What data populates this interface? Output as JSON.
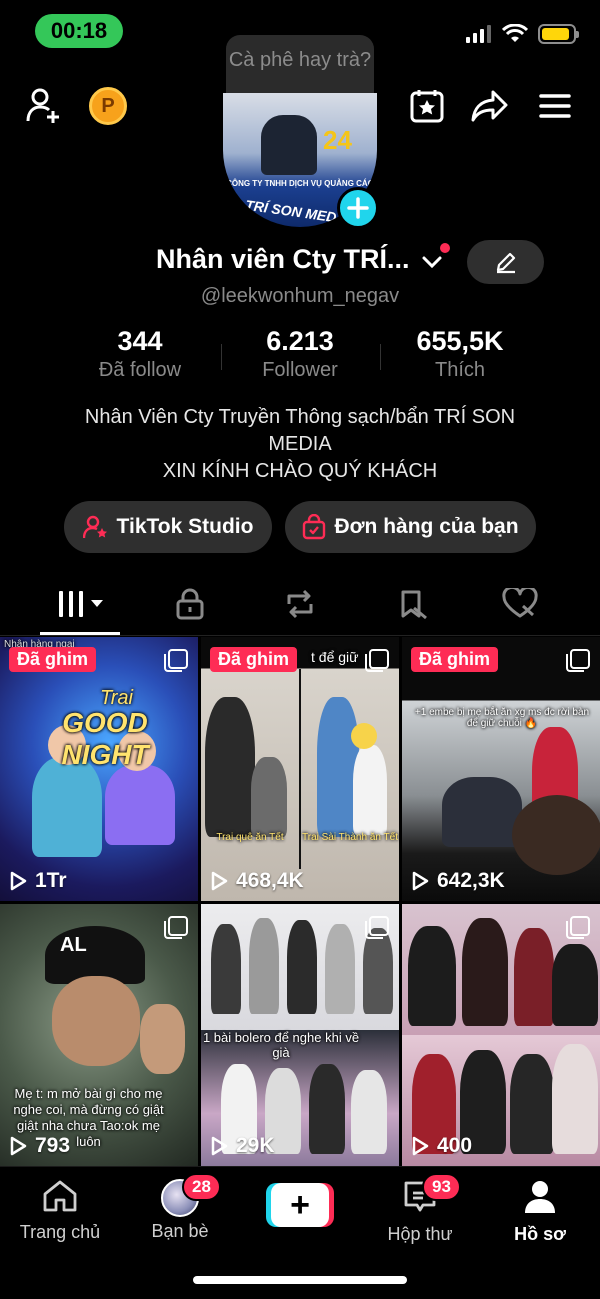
{
  "status_bar": {
    "time": "00:18",
    "battery_level": 0.9,
    "battery_color": "#ffd60a"
  },
  "top_nav": {
    "coin_label": "P",
    "tooltip": "Cà phê hay trà?"
  },
  "profile": {
    "avatar_badge": "24",
    "avatar_company": "CÔNG TY TNHH DỊCH VỤ QUẢNG CÁO",
    "avatar_brand": "TRÍ SON MED",
    "name": "Nhân viên Cty TRÍ...",
    "handle": "@leekwonhum_negav",
    "stats": [
      {
        "value": "344",
        "label": "Đã follow"
      },
      {
        "value": "6.213",
        "label": "Follower"
      },
      {
        "value": "655,5K",
        "label": "Thích"
      }
    ],
    "bio_line1": "Nhân Viên Cty Truyền Thông sạch/bẩn TRÍ SON",
    "bio_line2": "MEDIA",
    "bio_line3": "XIN KÍNH CHÀO QUÝ KHÁCH",
    "buttons": {
      "studio": "TikTok Studio",
      "orders": "Đơn hàng của bạn"
    }
  },
  "tabs": [
    "videos-tab",
    "private-tab",
    "repost-tab",
    "favorites-tab",
    "liked-tab"
  ],
  "videos": [
    {
      "pinned": "Đã ghim",
      "views": "1Tr",
      "overlay": "Nhân hàng ngại",
      "art_title": "GOOD NIGHT",
      "art_top": "Trai"
    },
    {
      "pinned": "Đã ghim",
      "views": "468,4K",
      "overlay": "t để giữ",
      "caption_left": "Trai quê ăn Tết",
      "caption_right": "Trai Sài Thành ăn Tết"
    },
    {
      "pinned": "Đã ghim",
      "views": "642,3K",
      "overlay": "+1 embe bị mẹ bắt ăn xg ms đc rời bàn để giữ chuỗi 🔥"
    },
    {
      "views": "793",
      "overlay": "Mẹ t: m mở bài gì cho mẹ nghe coi, mà đừng có giật giật nha chưa Tao:ok mẹ luôn",
      "cap_text": "AL"
    },
    {
      "views": "29K",
      "overlay": "1 bài bolero để nghe khi về già"
    },
    {
      "views": "400"
    }
  ],
  "bottom_nav": {
    "home": "Trang chủ",
    "friends": "Bạn bè",
    "friends_badge": "28",
    "inbox": "Hộp thư",
    "inbox_badge": "93",
    "profile": "Hồ sơ",
    "create": "+"
  },
  "colors": {
    "accent": "#fe2c55",
    "cyan": "#20d5ec",
    "status_green": "#34c759"
  }
}
